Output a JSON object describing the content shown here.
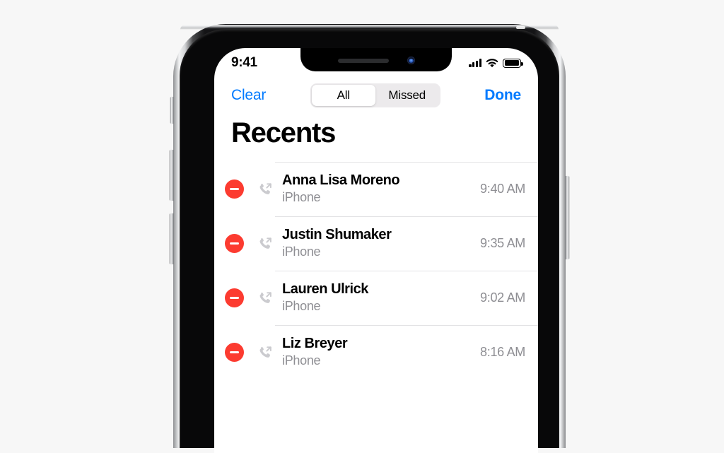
{
  "device": {
    "name": "iphone-x",
    "notch": {
      "speaker": "earpiece-speaker",
      "camera": "front-camera"
    },
    "buttons": {
      "mute_switch": "Ring/Silent switch",
      "volume_up": "Volume up",
      "volume_down": "Volume down",
      "side_button": "Side button"
    }
  },
  "status_bar": {
    "time": "9:41",
    "cellular_icon": "signal-bars-icon",
    "cellular_bars": 4,
    "wifi_icon": "wifi-icon",
    "battery_icon": "battery-icon",
    "battery_full": true
  },
  "nav_bar": {
    "clear_label": "Clear",
    "done_label": "Done",
    "segments": [
      {
        "label": "All",
        "selected": true
      },
      {
        "label": "Missed",
        "selected": false
      }
    ]
  },
  "page": {
    "title": "Recents"
  },
  "colors": {
    "accent_blue": "#007AFF",
    "destructive_red": "#FC3B30",
    "secondary_text": "#8E8E93",
    "separator": "#E3E3E5",
    "segment_track": "#ECEAEC",
    "page_background": "#F7F7F7"
  },
  "calls": [
    {
      "delete_icon": "minus-circle-icon",
      "call_type_icon": "outgoing-call-icon",
      "name": "Anna Lisa Moreno",
      "subtitle": "iPhone",
      "time": "9:40 AM"
    },
    {
      "delete_icon": "minus-circle-icon",
      "call_type_icon": "outgoing-call-icon",
      "name": "Justin Shumaker",
      "subtitle": "iPhone",
      "time": "9:35 AM"
    },
    {
      "delete_icon": "minus-circle-icon",
      "call_type_icon": "outgoing-call-icon",
      "name": "Lauren Ulrick",
      "subtitle": "iPhone",
      "time": "9:02 AM"
    },
    {
      "delete_icon": "minus-circle-icon",
      "call_type_icon": "outgoing-call-icon",
      "name": "Liz Breyer",
      "subtitle": "iPhone",
      "time": "8:16 AM"
    }
  ]
}
